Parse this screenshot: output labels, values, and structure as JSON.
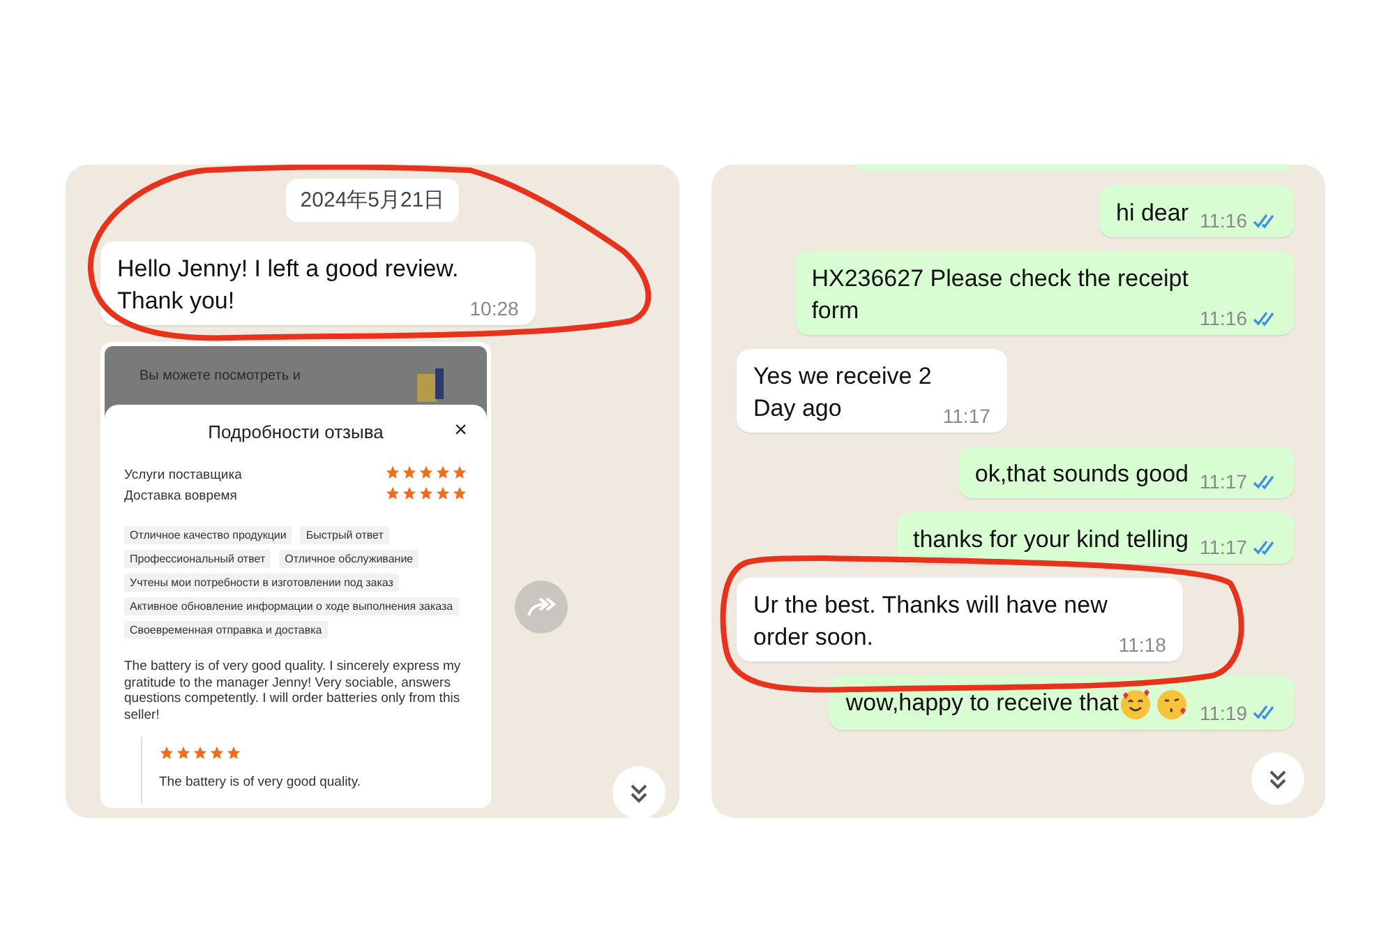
{
  "left_chat": {
    "date": "2024年5月21日",
    "message": {
      "outgoing": false,
      "text": "Hello Jenny!  I left a good review.\nThank you!",
      "time": "10:28"
    },
    "review_screenshot": {
      "banner_text": "Вы можете посмотреть и",
      "sheet_title": "Подробности отзыва",
      "close": "×",
      "ratings": [
        {
          "label": "Услуги поставщика",
          "stars": 5
        },
        {
          "label": "Доставка вовремя",
          "stars": 5
        }
      ],
      "tags": [
        "Отличное качество продукции",
        "Быстрый ответ",
        "Профессиональный ответ",
        "Отличное обслуживание",
        "Учтены мои потребности в изготовлении под заказ",
        "Активное обновление информации о ходе выполнения заказа",
        "Своевременная отправка и доставка"
      ],
      "review": "The battery is of very good quality.  I sincerely express my gratitude to the manager Jenny!  Very sociable, answers questions competently.  I will order batteries only from this seller!",
      "quote": {
        "stars": 5,
        "text": "The battery is of very good quality."
      }
    }
  },
  "right_chat": {
    "messages": [
      {
        "kind": "image",
        "outgoing": true
      },
      {
        "kind": "text",
        "outgoing": true,
        "text": "hi dear",
        "time": "11:16",
        "read": true
      },
      {
        "kind": "text",
        "outgoing": true,
        "text": "HX236627 Please check the receipt\nform",
        "time": "11:16",
        "read": true
      },
      {
        "kind": "text",
        "outgoing": false,
        "text": "Yes we receive 2\nDay ago",
        "time": "11:17"
      },
      {
        "kind": "text",
        "outgoing": true,
        "text": "ok,that sounds good",
        "time": "11:17",
        "read": true
      },
      {
        "kind": "text",
        "outgoing": true,
        "text": "thanks for your kind telling",
        "time": "11:17",
        "read": true
      },
      {
        "kind": "text",
        "outgoing": false,
        "text": "Ur the best.  Thanks will have new\norder soon.",
        "time": "11:18"
      },
      {
        "kind": "text",
        "outgoing": true,
        "text": "wow,happy to receive that",
        "time": "11:19",
        "read": true,
        "emoji": true
      }
    ]
  }
}
